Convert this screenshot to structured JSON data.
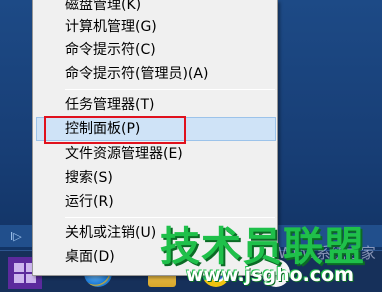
{
  "menu": {
    "items": [
      {
        "label": "磁盘管理(K)"
      },
      {
        "label": "计算机管理(G)"
      },
      {
        "label": "命令提示符(C)"
      },
      {
        "label": "命令提示符(管理员)(A)"
      },
      {
        "label": "任务管理器(T)"
      },
      {
        "label": "控制面板(P)"
      },
      {
        "label": "文件资源管理器(E)"
      },
      {
        "label": "搜索(S)"
      },
      {
        "label": "运行(R)"
      },
      {
        "label": "关机或注销(U)"
      },
      {
        "label": "桌面(D)"
      }
    ],
    "highlighted_item": "控制面板(P)"
  },
  "taskbar": {
    "side_marker": "I▷",
    "icons": [
      "start-icon",
      "internet-explorer-icon",
      "folder-icon",
      "chrome-icon",
      "qq-icon"
    ]
  },
  "watermark": {
    "logo": "技术员联盟",
    "url": "www.jsgho.com",
    "faint_text": "Win8系统之家"
  },
  "colors": {
    "menu_bg": "#f0f0f0",
    "hover_bg": "#cfe3f7",
    "highlight_box": "#e0111d",
    "watermark_green": "#1fc04a",
    "taskbar_bg": "#16305a"
  }
}
